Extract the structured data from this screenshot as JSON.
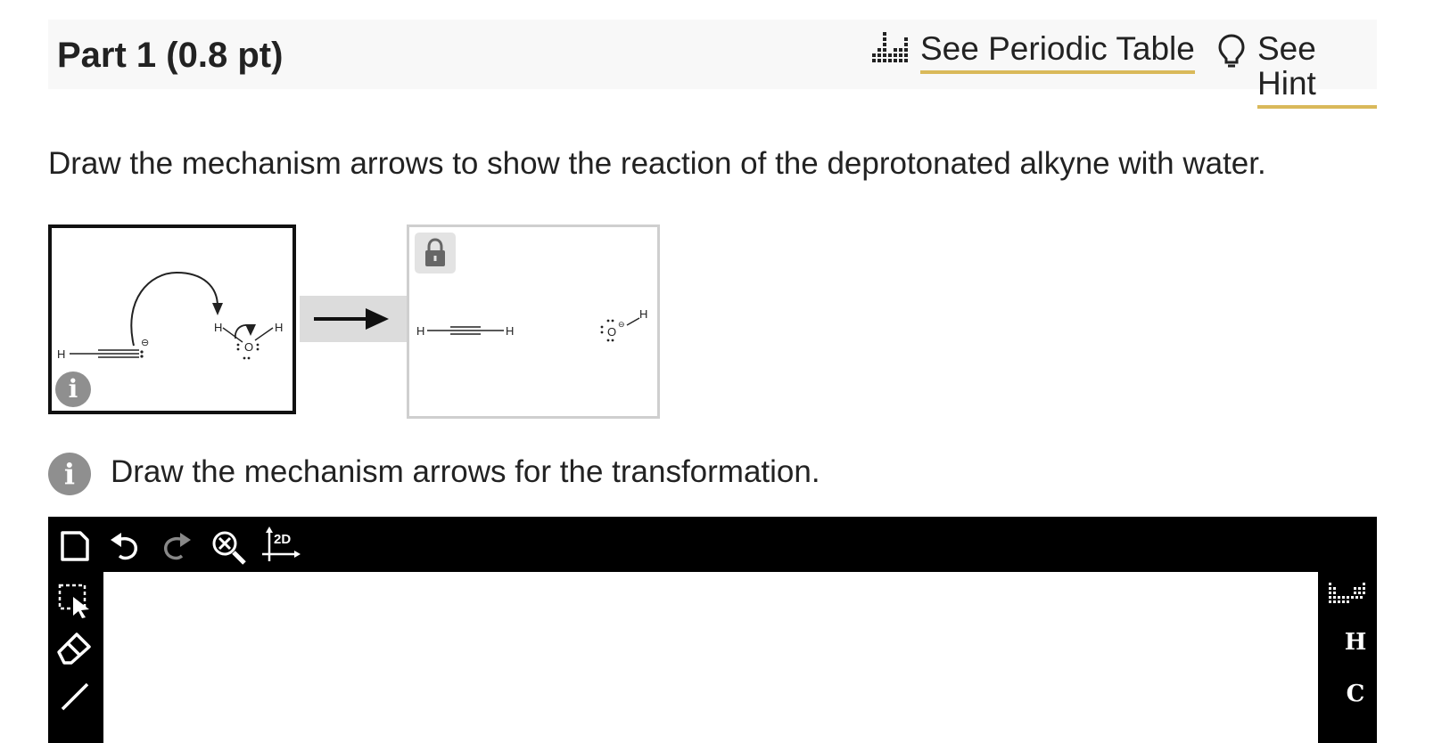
{
  "header": {
    "part_title": "Part 1 (0.8 pt)",
    "periodic_table_link": "See Periodic Table",
    "hint_link": "See Hint",
    "link_underline_color": "#d9b95a"
  },
  "question": {
    "instruction": "Draw the mechanism arrows to show the reaction of the deprotonated alkyne with water."
  },
  "reaction": {
    "reactant_labels": {
      "h_left": "H",
      "h_water_left": "H",
      "h_water_right": "H",
      "oxygen": "O",
      "charge": "⊖"
    },
    "product_labels": {
      "h_left": "H",
      "h_right": "H",
      "oxygen": "O",
      "h_oh": "H",
      "charge": "⊖"
    }
  },
  "editor_prompt": {
    "text": "Draw the mechanism arrows for the transformation."
  },
  "editor": {
    "top_tools": [
      "new-document-icon",
      "undo-icon",
      "redo-icon",
      "zoom-clear-icon",
      "2d-axes-icon"
    ],
    "axes_label": "2D",
    "left_tools": [
      "select-icon",
      "eraser-icon",
      "bond-icon"
    ],
    "elements": [
      "H",
      "C"
    ]
  }
}
